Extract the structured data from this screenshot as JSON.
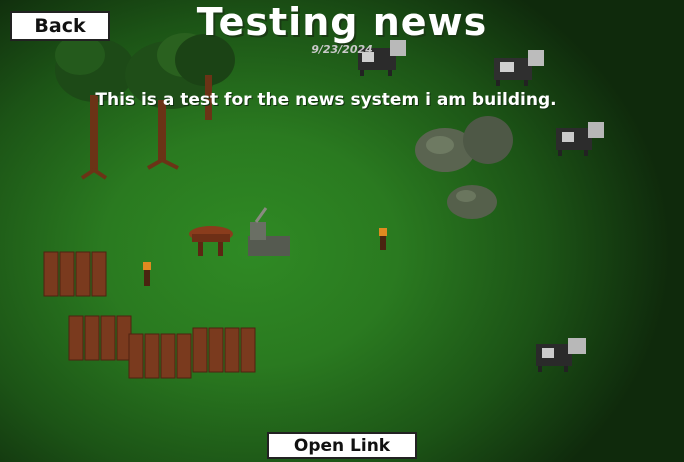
{
  "nav": {
    "back_label": "Back"
  },
  "news": {
    "title": "Testing news",
    "date": "9/23/2024",
    "body": "This is a test for the news system i am building."
  },
  "actions": {
    "open_link_label": "Open Link"
  },
  "colors": {
    "grass": "#2a7a20",
    "grass_dark": "#0f2a0c",
    "button_bg": "#ffffff",
    "text": "#ffffff",
    "fence": "#7a3a1e"
  },
  "scene_sprites": [
    "tree",
    "cow",
    "rock",
    "fence",
    "torch",
    "table",
    "crafting-bench"
  ]
}
